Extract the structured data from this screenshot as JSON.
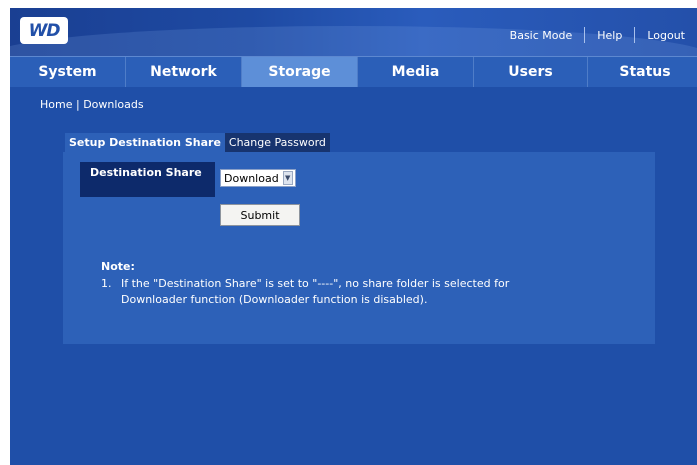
{
  "header": {
    "logo_text": "WD",
    "links": [
      "Basic Mode",
      "Help",
      "Logout"
    ]
  },
  "nav": {
    "tabs": [
      {
        "label": "System"
      },
      {
        "label": "Network"
      },
      {
        "label": "Storage",
        "active": true
      },
      {
        "label": "Media"
      },
      {
        "label": "Users"
      },
      {
        "label": "Status"
      }
    ]
  },
  "breadcrumb": {
    "home": "Home",
    "separator": "|",
    "current": "Downloads"
  },
  "subtabs": [
    {
      "label": "Setup Destination Share",
      "active": true
    },
    {
      "label": "Change Password",
      "active": false
    }
  ],
  "form": {
    "destination_label": "Destination Share",
    "destination_value": "Download",
    "submit_label": "Submit"
  },
  "note": {
    "title": "Note:",
    "item_number": "1.",
    "text_line1": "If the \"Destination Share\" is set to \"----\", no share folder is selected for",
    "text_line2": "Downloader function (Downloader function is disabled)."
  },
  "colors": {
    "background": "#1f4fa8",
    "active_tab": "#5d8fd8",
    "panel": "#2d61b8",
    "label_bg": "#0d2a6b"
  }
}
